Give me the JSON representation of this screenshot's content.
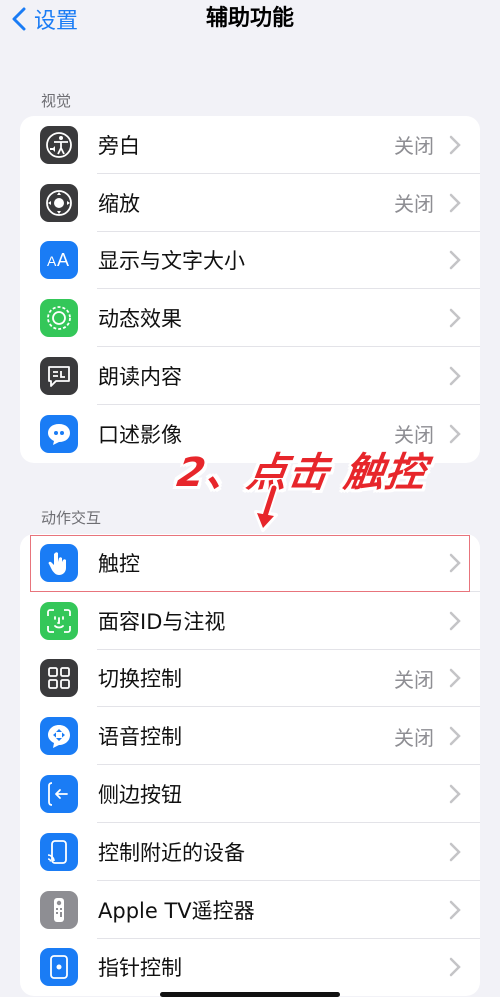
{
  "nav": {
    "back_label": "设置",
    "title": "辅助功能"
  },
  "sections": [
    {
      "label": "视觉",
      "items": [
        {
          "label": "旁白",
          "value": "关闭",
          "icon": "voiceover-icon",
          "color": "#3a3a3c"
        },
        {
          "label": "缩放",
          "value": "关闭",
          "icon": "zoom-icon",
          "color": "#3a3a3c"
        },
        {
          "label": "显示与文字大小",
          "value": "",
          "icon": "text-size-icon",
          "color": "#1a7cf5"
        },
        {
          "label": "动态效果",
          "value": "",
          "icon": "motion-icon",
          "color": "#34c759"
        },
        {
          "label": "朗读内容",
          "value": "",
          "icon": "spoken-content-icon",
          "color": "#3a3a3c"
        },
        {
          "label": "口述影像",
          "value": "关闭",
          "icon": "audio-description-icon",
          "color": "#1a7cf5"
        }
      ]
    },
    {
      "label": "动作交互",
      "items": [
        {
          "label": "触控",
          "value": "",
          "icon": "touch-hand-icon",
          "color": "#1a7cf5"
        },
        {
          "label": "面容ID与注视",
          "value": "",
          "icon": "face-id-icon",
          "color": "#34c759"
        },
        {
          "label": "切换控制",
          "value": "关闭",
          "icon": "switch-control-icon",
          "color": "#3a3a3c"
        },
        {
          "label": "语音控制",
          "value": "关闭",
          "icon": "voice-control-icon",
          "color": "#1a7cf5"
        },
        {
          "label": "侧边按钮",
          "value": "",
          "icon": "side-button-icon",
          "color": "#1a7cf5"
        },
        {
          "label": "控制附近的设备",
          "value": "",
          "icon": "nearby-devices-icon",
          "color": "#1a7cf5"
        },
        {
          "label": "Apple TV遥控器",
          "value": "",
          "icon": "tv-remote-icon",
          "color": "#8e8e93"
        },
        {
          "label": "指针控制",
          "value": "",
          "icon": "pointer-control-icon",
          "color": "#1a7cf5"
        }
      ]
    }
  ],
  "annotation": {
    "text": "2、点击 触控"
  }
}
